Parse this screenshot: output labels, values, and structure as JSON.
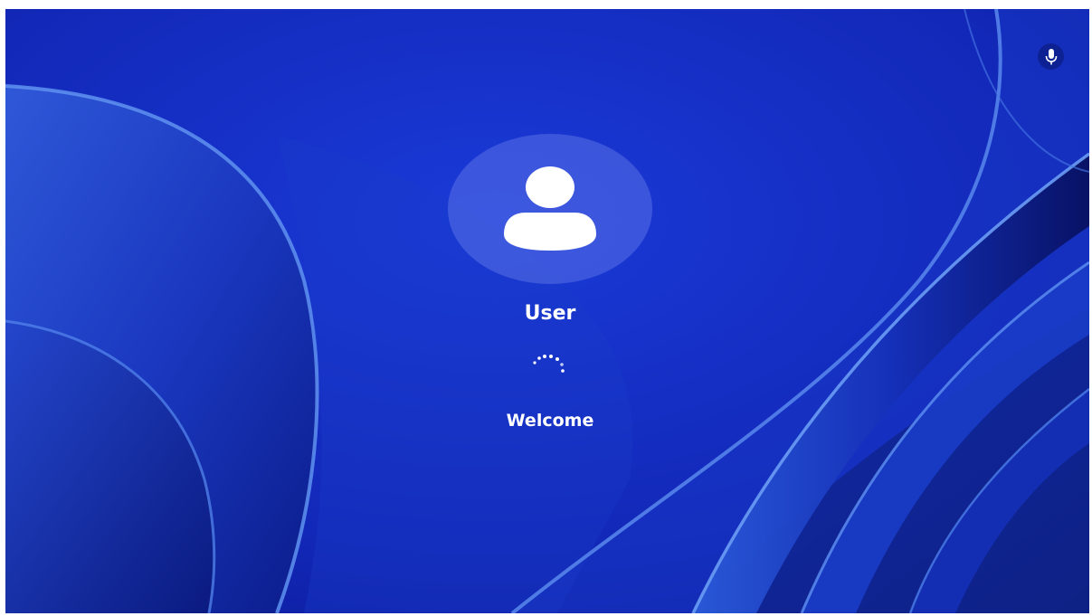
{
  "screen": {
    "type": "sign-in",
    "state": "signing in",
    "user": {
      "name": "User",
      "avatar_icon": "person-icon"
    },
    "status_text": "Welcome",
    "loading_icon": "dots-spinner-icon",
    "accessibility": {
      "icon": "microphone-icon"
    }
  },
  "colors": {
    "background_blue": "#1530c8",
    "ribbon_light": "#3f78e4",
    "ribbon_dark": "#0a1a78",
    "text": "#ffffff"
  }
}
